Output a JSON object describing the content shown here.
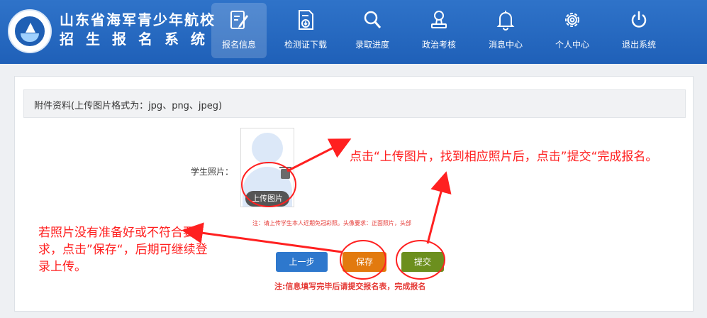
{
  "header": {
    "title_line1": "山东省海军青少年航校",
    "title_line2": "招生报名系统",
    "nav": [
      {
        "label": "报名信息",
        "icon": "form-edit-icon",
        "active": true
      },
      {
        "label": "检测证下载",
        "icon": "download-doc-icon",
        "active": false
      },
      {
        "label": "录取进度",
        "icon": "search-icon",
        "active": false
      },
      {
        "label": "政治考核",
        "icon": "review-stamp-icon",
        "active": false
      },
      {
        "label": "消息中心",
        "icon": "bell-icon",
        "active": false
      },
      {
        "label": "个人中心",
        "icon": "gear-icon",
        "active": false
      },
      {
        "label": "退出系统",
        "icon": "power-icon",
        "active": false
      }
    ]
  },
  "section": {
    "title": "附件资料(上传图片格式为：jpg、png、jpeg)"
  },
  "photo": {
    "label": "学生照片：",
    "upload_label": "上传图片",
    "note": "注：请上传学生本人近期免冠彩照。头像要求：正面照片，头部"
  },
  "actions": {
    "prev_label": "上一步",
    "save_label": "保存",
    "submit_label": "提交",
    "note": "注:信息填写完毕后请提交报名表，完成报名"
  },
  "annotations": {
    "right": "点击“上传图片，找到相应照片后，点击”提交“完成报名。",
    "left": "若照片没有准备好或不符合要求，点击”保存“，后期可继续登录上传。"
  },
  "colors": {
    "header": "#1f60b8",
    "prev": "#2e78cd",
    "save": "#e27a0e",
    "submit": "#6c8f1e",
    "annotation": "#ff2020"
  }
}
